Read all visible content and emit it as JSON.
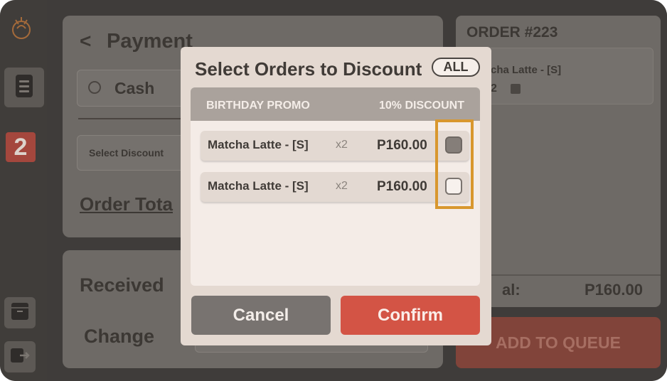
{
  "sidebar": {
    "badge": "2",
    "logo_icon": "coffee-logo-icon",
    "menu_icon": "document-icon",
    "archive_icon": "archive-icon",
    "logout_icon": "logout-icon"
  },
  "payment": {
    "title": "Payment",
    "back_icon": "chevron-left-icon",
    "method_cash": "Cash",
    "select_discount": "Select Discount",
    "order_total_label": "Order Tota",
    "received_label": "Received",
    "change_label": "Change"
  },
  "order": {
    "title": "ORDER #223",
    "item_name": "cha Latte - [S]",
    "item_qty": "2",
    "total_label": "al:",
    "total_value": "P160.00",
    "queue_button": "ADD TO QUEUE"
  },
  "modal": {
    "title": "Select Orders to Discount",
    "all_button": "ALL",
    "promo_name": "BIRTHDAY PROMO",
    "promo_discount": "10% DISCOUNT",
    "rows": [
      {
        "name": "Matcha Latte - [S]",
        "qty": "x2",
        "price": "P160.00",
        "checked": true
      },
      {
        "name": "Matcha Latte - [S]",
        "qty": "x2",
        "price": "P160.00",
        "checked": false
      }
    ],
    "cancel_button": "Cancel",
    "confirm_button": "Confirm"
  },
  "colors": {
    "accent": "#d35445",
    "highlight": "#d8972e",
    "modal_bg": "#e4d9d1"
  }
}
